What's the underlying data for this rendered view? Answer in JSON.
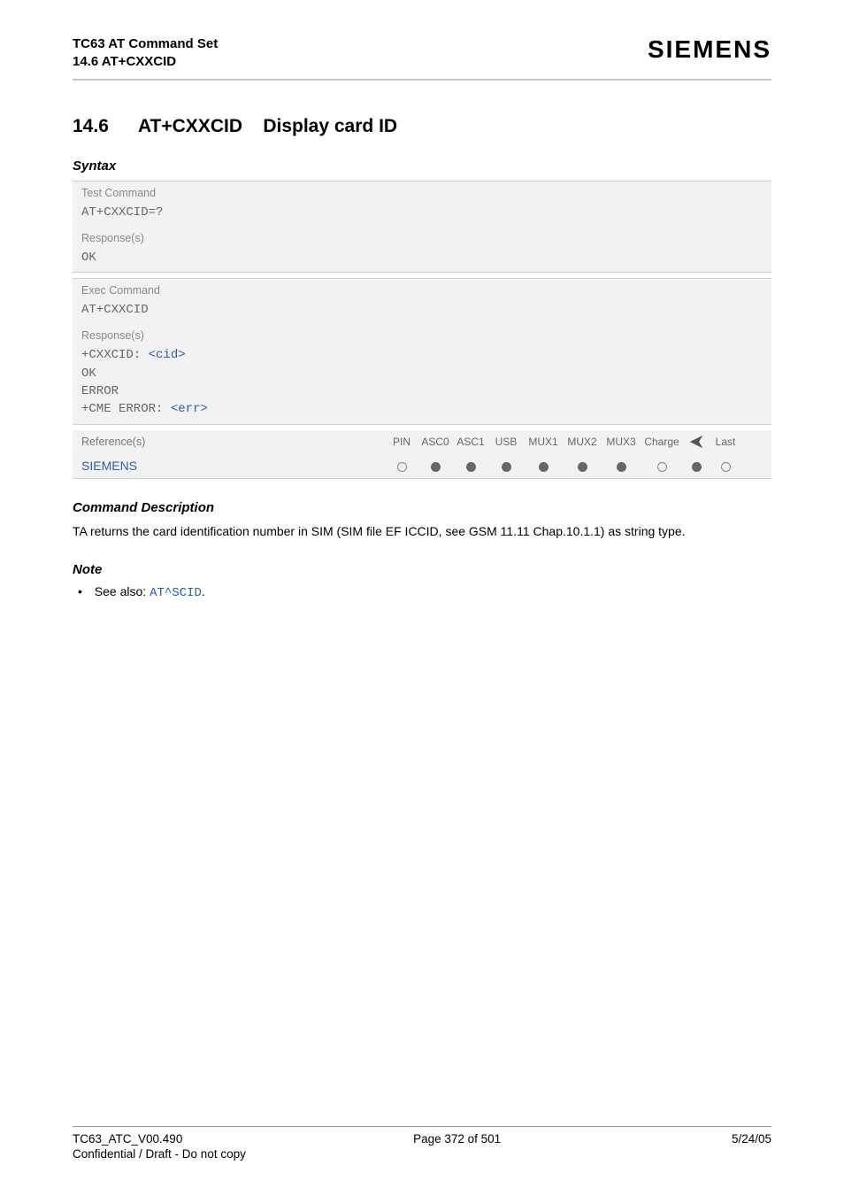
{
  "header": {
    "doc_title": "TC63 AT Command Set",
    "section_ref": "14.6 AT+CXXCID",
    "brand": "SIEMENS"
  },
  "section": {
    "number": "14.6",
    "command": "AT+CXXCID",
    "title": "Display card ID"
  },
  "syntax": {
    "heading": "Syntax",
    "test": {
      "label": "Test Command",
      "cmd": "AT+CXXCID=?",
      "resp_label": "Response(s)",
      "resp": "OK"
    },
    "exec": {
      "label": "Exec Command",
      "cmd": "AT+CXXCID",
      "resp_label": "Response(s)",
      "resp_prefix": "+CXXCID: ",
      "resp_param": "<cid>",
      "resp_ok": "OK",
      "resp_err": "ERROR",
      "resp_cme_prefix": "+CME ERROR: ",
      "resp_cme_param": "<err>"
    },
    "refs": {
      "label": "Reference(s)",
      "value": "SIEMENS",
      "cols": {
        "pin": "PIN",
        "asc0": "ASC0",
        "asc1": "ASC1",
        "usb": "USB",
        "mux1": "MUX1",
        "mux2": "MUX2",
        "mux3": "MUX3",
        "charge": "Charge",
        "last": "Last"
      },
      "vals": {
        "pin": "open",
        "asc0": "fill",
        "asc1": "fill",
        "usb": "fill",
        "mux1": "fill",
        "mux2": "fill",
        "mux3": "fill",
        "charge": "open",
        "air": "fill",
        "last": "open"
      }
    }
  },
  "cmd_desc": {
    "heading": "Command Description",
    "text": "TA returns the card identification number in SIM (SIM file EF ICCID, see GSM 11.11 Chap.10.1.1) as string type."
  },
  "note": {
    "heading": "Note",
    "prefix": "See also: ",
    "link": "AT^SCID",
    "suffix": "."
  },
  "footer": {
    "version": "TC63_ATC_V00.490",
    "page": "Page 372 of 501",
    "date": "5/24/05",
    "confidential": "Confidential / Draft - Do not copy"
  }
}
